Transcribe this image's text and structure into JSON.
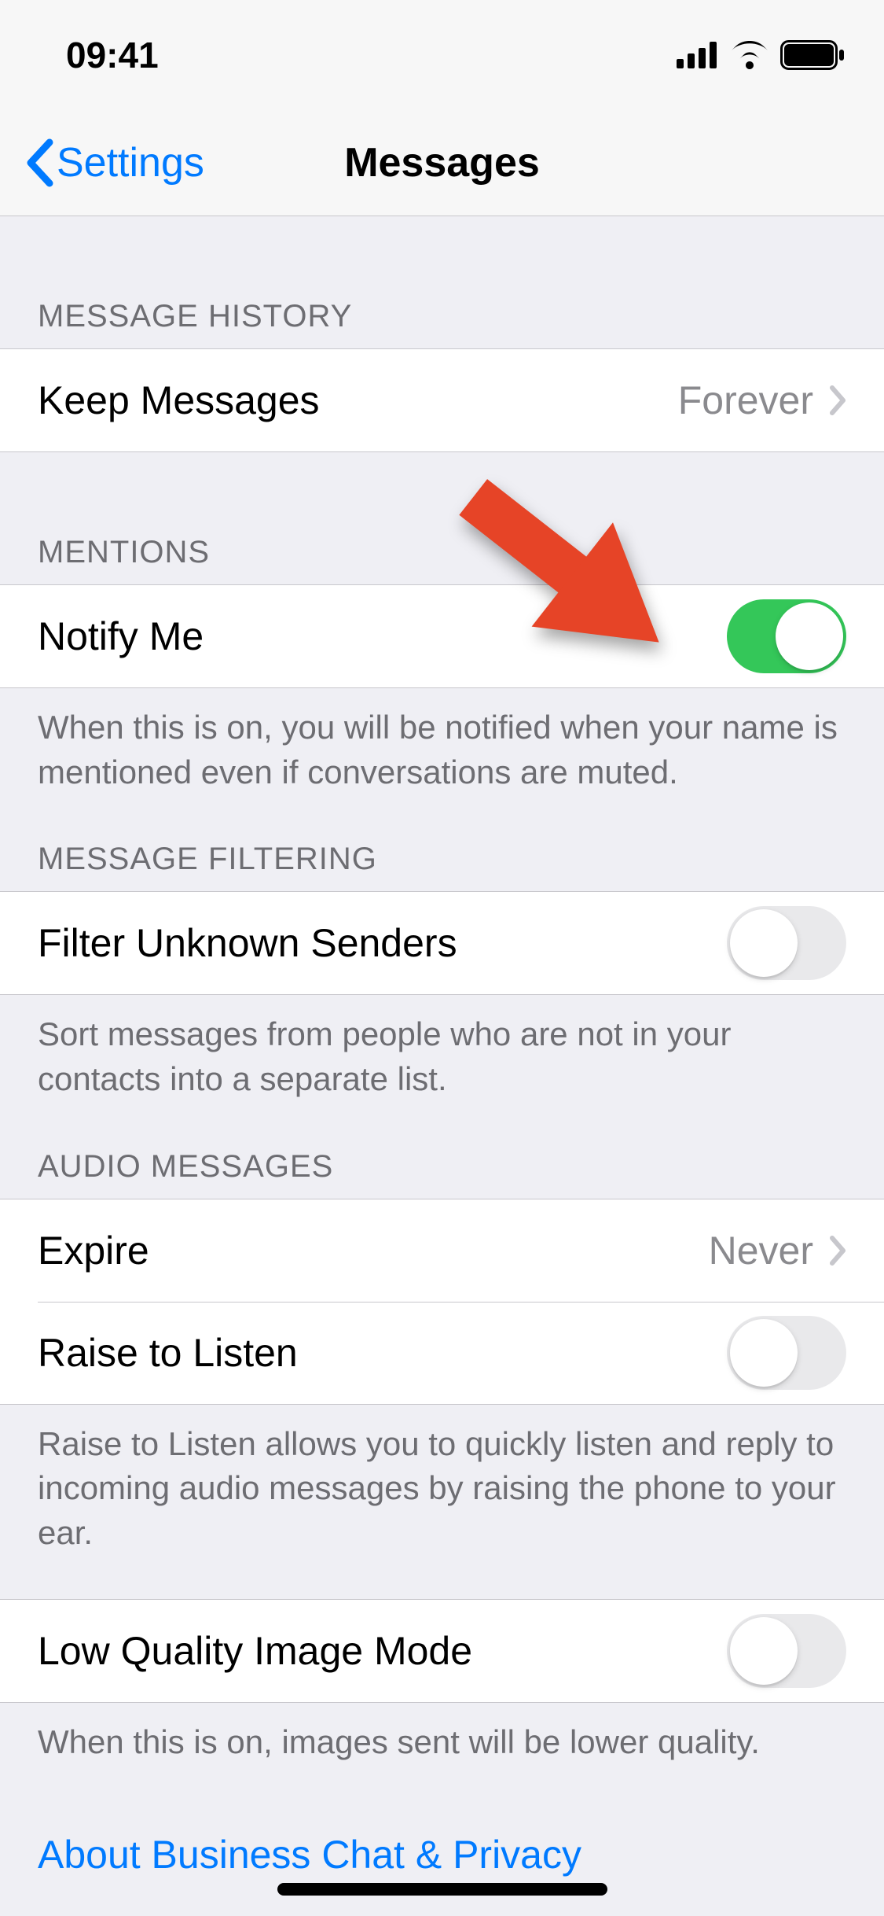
{
  "status_bar": {
    "time": "09:41"
  },
  "nav": {
    "back_label": "Settings",
    "title": "Messages"
  },
  "sections": {
    "message_history": {
      "header": "MESSAGE HISTORY",
      "keep_messages": {
        "label": "Keep Messages",
        "value": "Forever"
      }
    },
    "mentions": {
      "header": "MENTIONS",
      "notify_me": {
        "label": "Notify Me",
        "on": true
      },
      "footer": "When this is on, you will be notified when your name is mentioned even if conversations are muted."
    },
    "message_filtering": {
      "header": "MESSAGE FILTERING",
      "filter_unknown": {
        "label": "Filter Unknown Senders",
        "on": false
      },
      "footer": "Sort messages from people who are not in your contacts into a separate list."
    },
    "audio_messages": {
      "header": "AUDIO MESSAGES",
      "expire": {
        "label": "Expire",
        "value": "Never"
      },
      "raise_to_listen": {
        "label": "Raise to Listen",
        "on": false
      },
      "footer": "Raise to Listen allows you to quickly listen and reply to incoming audio messages by raising the phone to your ear."
    },
    "low_quality": {
      "label": "Low Quality Image Mode",
      "on": false,
      "footer": "When this is on, images sent will be lower quality."
    },
    "about_link": "About Business Chat & Privacy"
  }
}
